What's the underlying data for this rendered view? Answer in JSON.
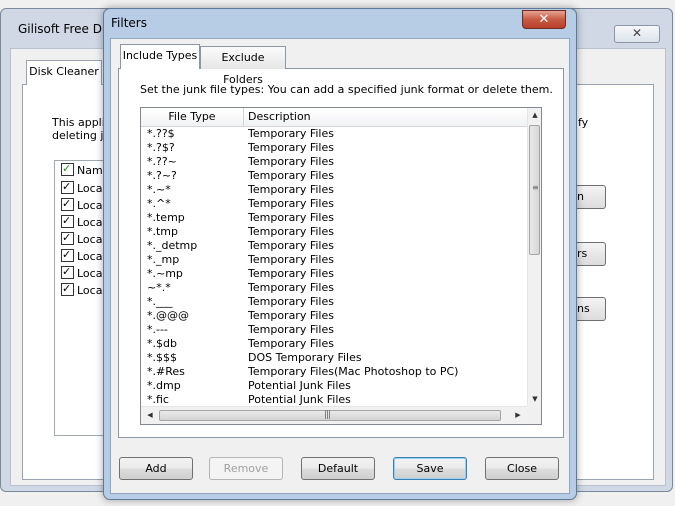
{
  "background_window": {
    "title": "Gilisoft Free Di",
    "close_glyph": "✕",
    "tab_label": "Disk Cleaner",
    "info_lines": [
      "This applica",
      "deleting ju"
    ],
    "info_right": "fy",
    "list_header": "Name",
    "list_items": [
      "Local",
      "Local",
      "Local",
      "Local",
      "Local",
      "Local",
      "Local"
    ],
    "button_fragments": [
      "n",
      "rs",
      "ns"
    ]
  },
  "dialog": {
    "title": "Filters",
    "close_glyph": "✕",
    "tabs": [
      {
        "label": "Include Types",
        "active": true
      },
      {
        "label": "Exclude Folders",
        "active": false
      }
    ],
    "instruction": "Set the junk file types: You can add a specified junk format or delete them.",
    "columns": [
      "File Type",
      "Description"
    ],
    "rows": [
      {
        "type": "*.??$",
        "desc": "Temporary Files"
      },
      {
        "type": "*.?$?",
        "desc": "Temporary Files"
      },
      {
        "type": "*.??~",
        "desc": "Temporary Files"
      },
      {
        "type": "*.?~?",
        "desc": "Temporary Files"
      },
      {
        "type": "*.~*",
        "desc": "Temporary Files"
      },
      {
        "type": "*.^*",
        "desc": "Temporary Files"
      },
      {
        "type": "*.temp",
        "desc": "Temporary Files"
      },
      {
        "type": "*.tmp",
        "desc": "Temporary Files"
      },
      {
        "type": "*._detmp",
        "desc": "Temporary Files"
      },
      {
        "type": "*._mp",
        "desc": "Temporary Files"
      },
      {
        "type": "*.~mp",
        "desc": "Temporary Files"
      },
      {
        "type": "~*.*",
        "desc": "Temporary Files"
      },
      {
        "type": "*.___",
        "desc": "Temporary Files"
      },
      {
        "type": "*.@@@",
        "desc": "Temporary Files"
      },
      {
        "type": "*.---",
        "desc": "Temporary Files"
      },
      {
        "type": "*.$db",
        "desc": "Temporary Files"
      },
      {
        "type": "*.$$$",
        "desc": "DOS Temporary Files"
      },
      {
        "type": "*.#Res",
        "desc": "Temporary Files(Mac Photoshop to PC)"
      },
      {
        "type": "*.dmp",
        "desc": "Potential Junk Files"
      },
      {
        "type": "*.fic",
        "desc": "Potential Junk Files"
      }
    ],
    "scroll": {
      "up": "▲",
      "down": "▼",
      "left": "◀",
      "right": "▶",
      "v_grip": "≡",
      "h_grip": "|||"
    },
    "buttons": {
      "add": "Add",
      "remove": "Remove",
      "default": "Default",
      "save": "Save",
      "close": "Close"
    }
  }
}
